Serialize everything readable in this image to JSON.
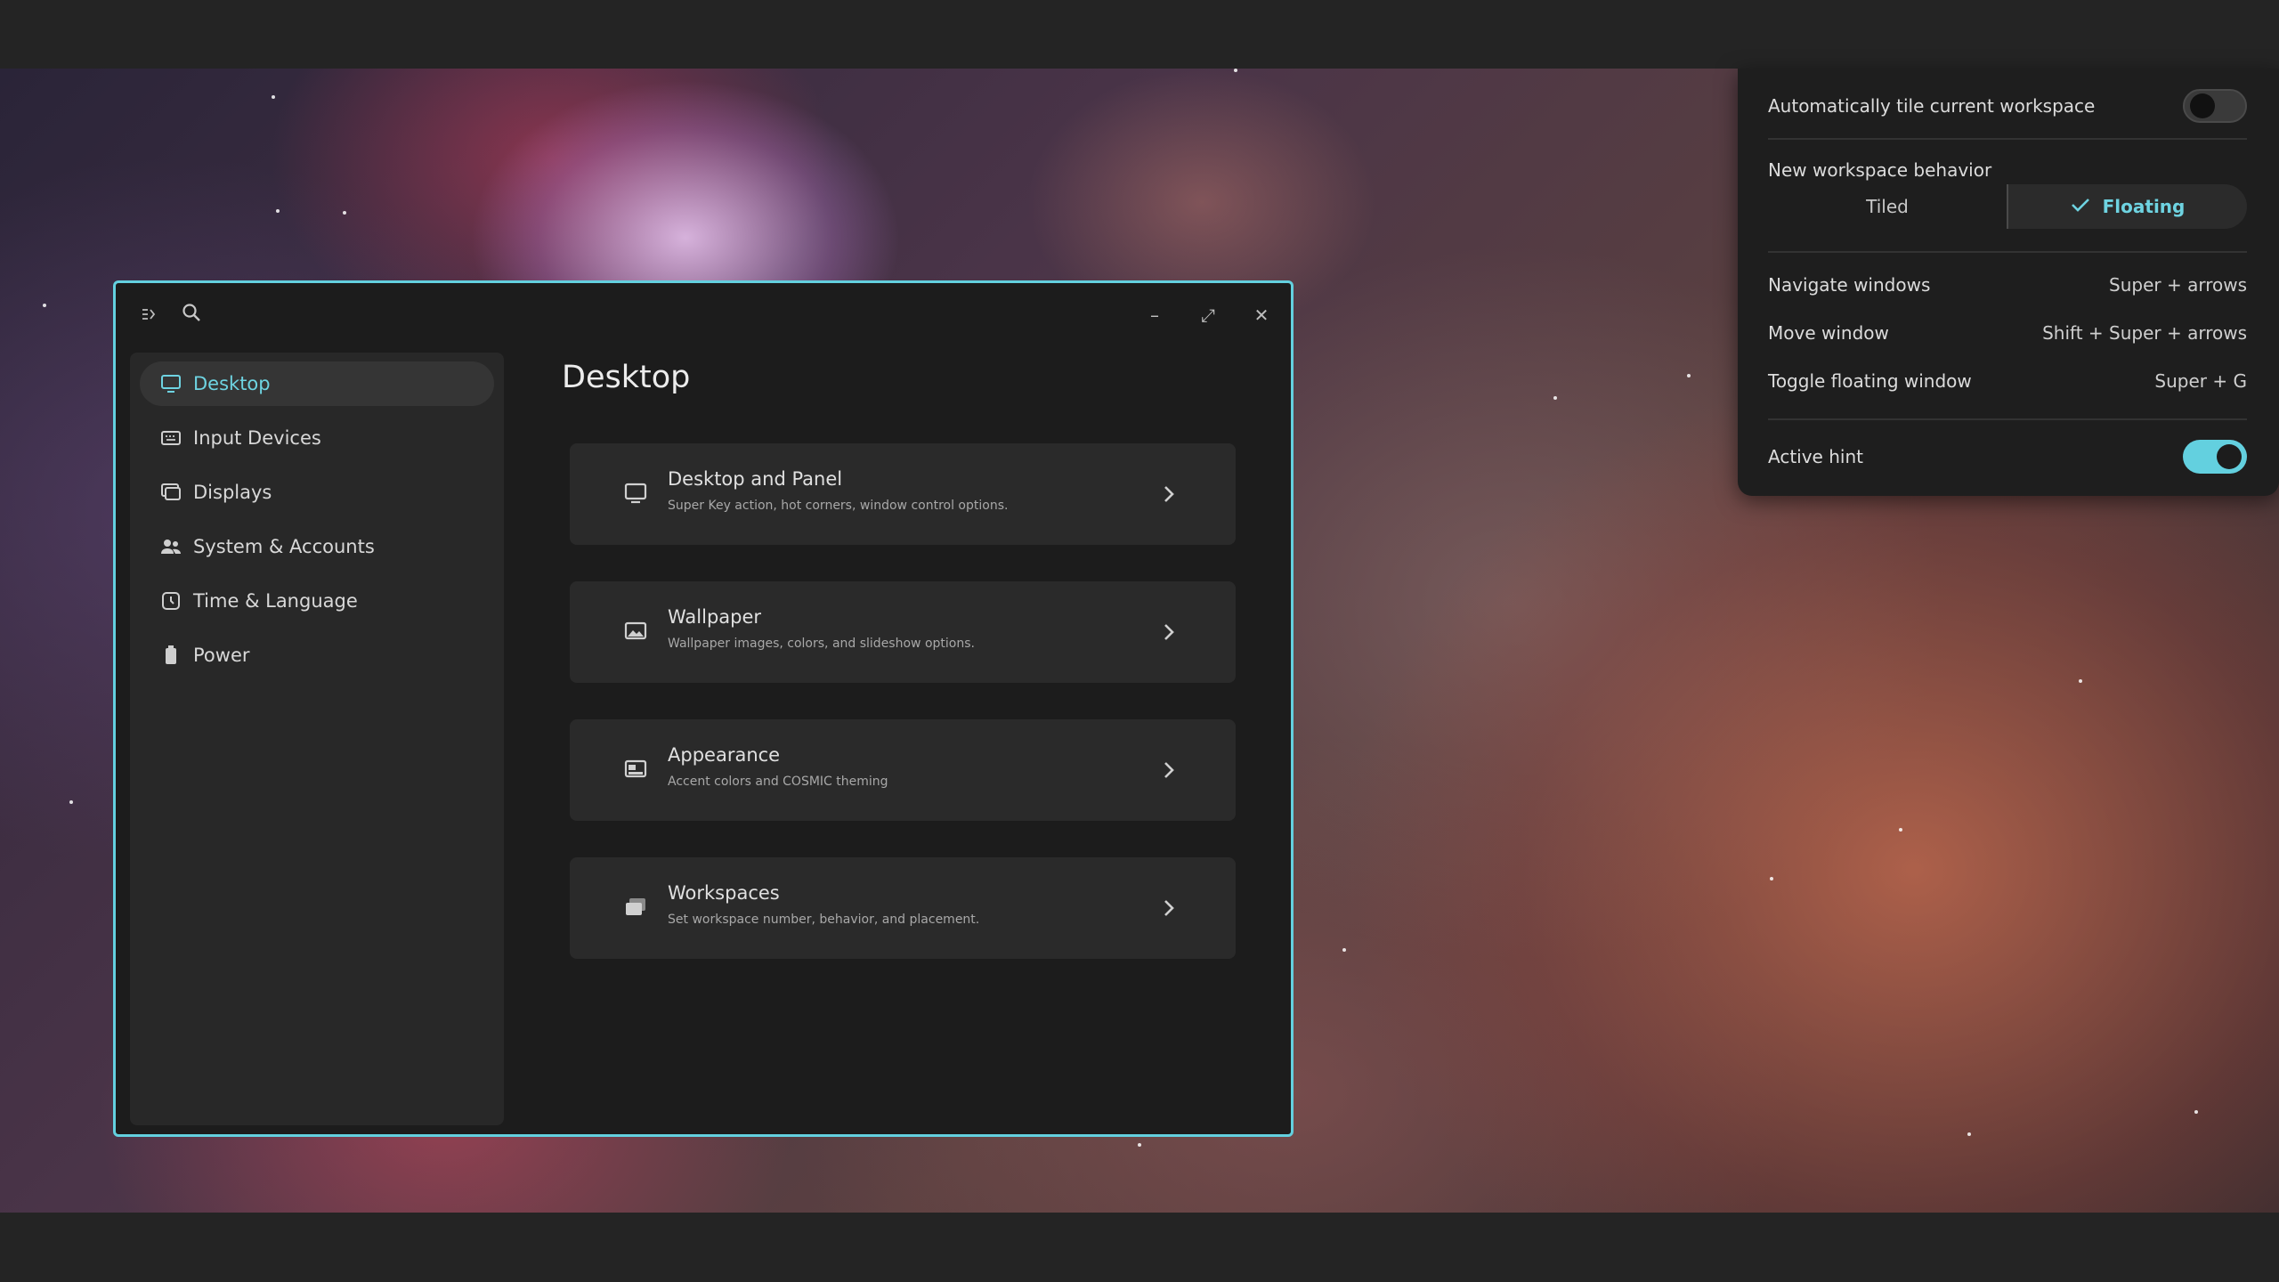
{
  "window": {
    "title": "Desktop",
    "sidebar": {
      "items": [
        {
          "label": "Desktop",
          "icon": "monitor-icon",
          "active": true
        },
        {
          "label": "Input Devices",
          "icon": "keyboard-icon",
          "active": false
        },
        {
          "label": "Displays",
          "icon": "displays-icon",
          "active": false
        },
        {
          "label": "System & Accounts",
          "icon": "users-icon",
          "active": false
        },
        {
          "label": "Time & Language",
          "icon": "clock-icon",
          "active": false
        },
        {
          "label": "Power",
          "icon": "battery-icon",
          "active": false
        }
      ]
    },
    "cards": [
      {
        "title": "Desktop and Panel",
        "description": "Super Key action, hot corners, window control options.",
        "icon": "desktop-panel-icon"
      },
      {
        "title": "Wallpaper",
        "description": "Wallpaper images, colors, and slideshow options.",
        "icon": "wallpaper-icon"
      },
      {
        "title": "Appearance",
        "description": "Accent colors and COSMIC theming",
        "icon": "appearance-icon"
      },
      {
        "title": "Workspaces",
        "description": "Set workspace number, behavior, and placement.",
        "icon": "workspaces-icon"
      }
    ],
    "controls": {
      "minimize": "–",
      "maximize": "⤢",
      "close": "✕"
    }
  },
  "popup": {
    "auto_tile": {
      "label": "Automatically tile current workspace",
      "enabled": false
    },
    "new_workspace": {
      "label": "New workspace behavior",
      "options": [
        "Tiled",
        "Floating"
      ],
      "selected": "Floating"
    },
    "shortcuts": [
      {
        "label": "Navigate windows",
        "keys": "Super + arrows"
      },
      {
        "label": "Move window",
        "keys": "Shift + Super + arrows"
      },
      {
        "label": "Toggle floating window",
        "keys": "Super + G"
      }
    ],
    "active_hint": {
      "label": "Active hint",
      "enabled": true
    }
  },
  "colors": {
    "accent": "#63d0df",
    "window_bg": "#1c1c1c",
    "card_bg": "#2a2a2a"
  }
}
